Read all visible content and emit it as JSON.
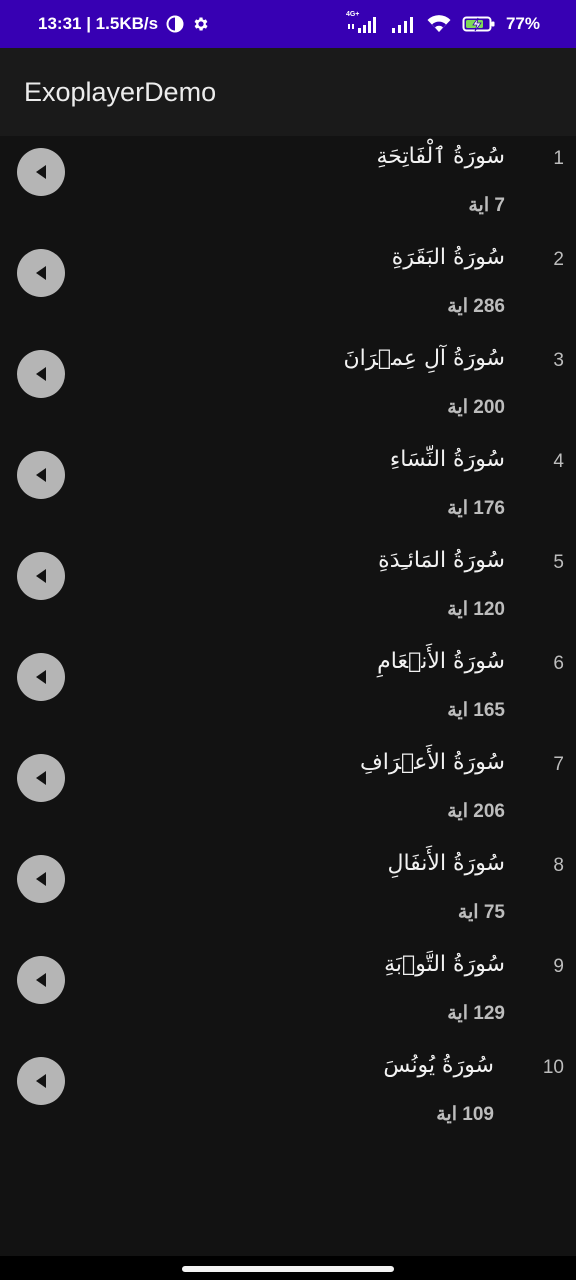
{
  "status_bar": {
    "time_speed": "13:31 | 1.5KB/s",
    "network_small": "4G+",
    "battery": "77%"
  },
  "app": {
    "title": "ExoplayerDemo"
  },
  "surahs": [
    {
      "index": "1",
      "name": "سُورَةُ ٱلْفَاتِحَةِ",
      "ayah_label": "7 اية"
    },
    {
      "index": "2",
      "name": "سُورَةُ البَقَرَةِ",
      "ayah_label": "286 اية"
    },
    {
      "index": "3",
      "name": "سُورَةُ آلِ عِمۡرَانَ",
      "ayah_label": "200 اية"
    },
    {
      "index": "4",
      "name": "سُورَةُ النِّسَاءِ",
      "ayah_label": "176 اية"
    },
    {
      "index": "5",
      "name": "سُورَةُ المَائـِدَةِ",
      "ayah_label": "120 اية"
    },
    {
      "index": "6",
      "name": "سُورَةُ الأَنۡعَامِ",
      "ayah_label": "165 اية"
    },
    {
      "index": "7",
      "name": "سُورَةُ الأَعۡرَافِ",
      "ayah_label": "206 اية"
    },
    {
      "index": "8",
      "name": "سُورَةُ الأَنفَالِ",
      "ayah_label": "75 اية"
    },
    {
      "index": "9",
      "name": "سُورَةُ التَّوۡبَةِ",
      "ayah_label": "129 اية"
    },
    {
      "index": "10",
      "name": "سُورَةُ يُونُسَ",
      "ayah_label": "109 اية"
    }
  ],
  "icons": {
    "play": "play-icon"
  },
  "colors": {
    "status_bar": "#3700b3",
    "background": "#121212",
    "play_button": "#b5b5b5"
  }
}
